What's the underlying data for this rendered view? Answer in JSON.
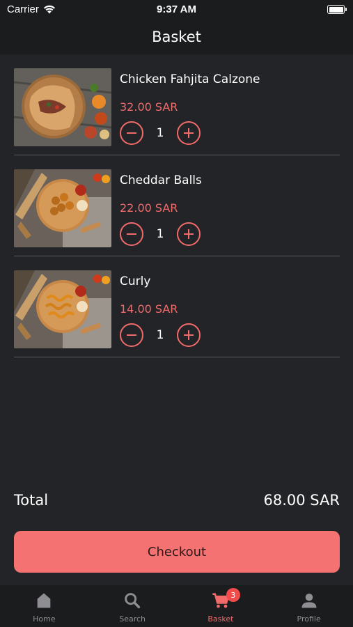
{
  "status_bar": {
    "carrier": "Carrier",
    "time": "9:37 AM"
  },
  "header": {
    "title": "Basket"
  },
  "items": [
    {
      "name": "Chicken Fahjita Calzone",
      "price": "32.00 SAR",
      "quantity": "1"
    },
    {
      "name": "Cheddar Balls",
      "price": "22.00 SAR",
      "quantity": "1"
    },
    {
      "name": "Curly",
      "price": "14.00 SAR",
      "quantity": "1"
    }
  ],
  "total": {
    "label": "Total",
    "amount": "68.00 SAR"
  },
  "checkout": {
    "label": "Checkout"
  },
  "tabs": [
    {
      "label": "Home",
      "icon": "home-icon"
    },
    {
      "label": "Search",
      "icon": "search-icon"
    },
    {
      "label": "Basket",
      "icon": "cart-icon",
      "badge": "3",
      "active": true
    },
    {
      "label": "Profile",
      "icon": "person-icon"
    }
  ],
  "colors": {
    "accent": "#f26a6a",
    "background": "#232427",
    "bar": "#1b1c1e",
    "checkout": "#f47272"
  }
}
